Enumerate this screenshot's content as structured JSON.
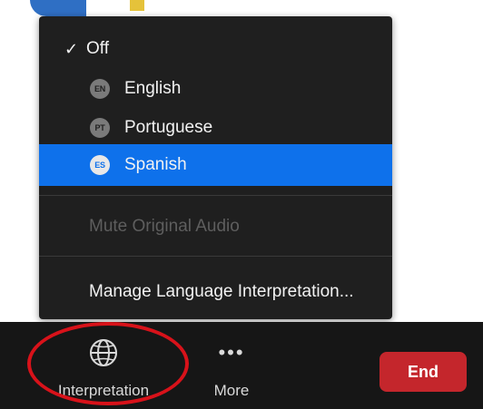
{
  "menu": {
    "items": [
      {
        "label": "Off",
        "checked": true,
        "icon": "checkmark-icon"
      },
      {
        "label": "English",
        "badge": "EN"
      },
      {
        "label": "Portuguese",
        "badge": "PT"
      },
      {
        "label": "Spanish",
        "badge": "ES",
        "selected": true
      }
    ],
    "mute_original_audio": {
      "label": "Mute Original Audio",
      "disabled": true
    },
    "manage_interpretation": {
      "label": "Manage Language Interpretation..."
    }
  },
  "toolbar": {
    "interpretation": {
      "label": "Interpretation",
      "icon": "globe-icon"
    },
    "more": {
      "label": "More",
      "icon": "ellipsis-icon"
    },
    "end": {
      "label": "End"
    }
  },
  "colors": {
    "menu_bg": "#1f1f1f",
    "selected_bg": "#0e71eb",
    "toolbar_bg": "#161616",
    "end_button": "#c4262c",
    "highlight": "#d8121a",
    "disabled_text": "#5e5e5e"
  }
}
